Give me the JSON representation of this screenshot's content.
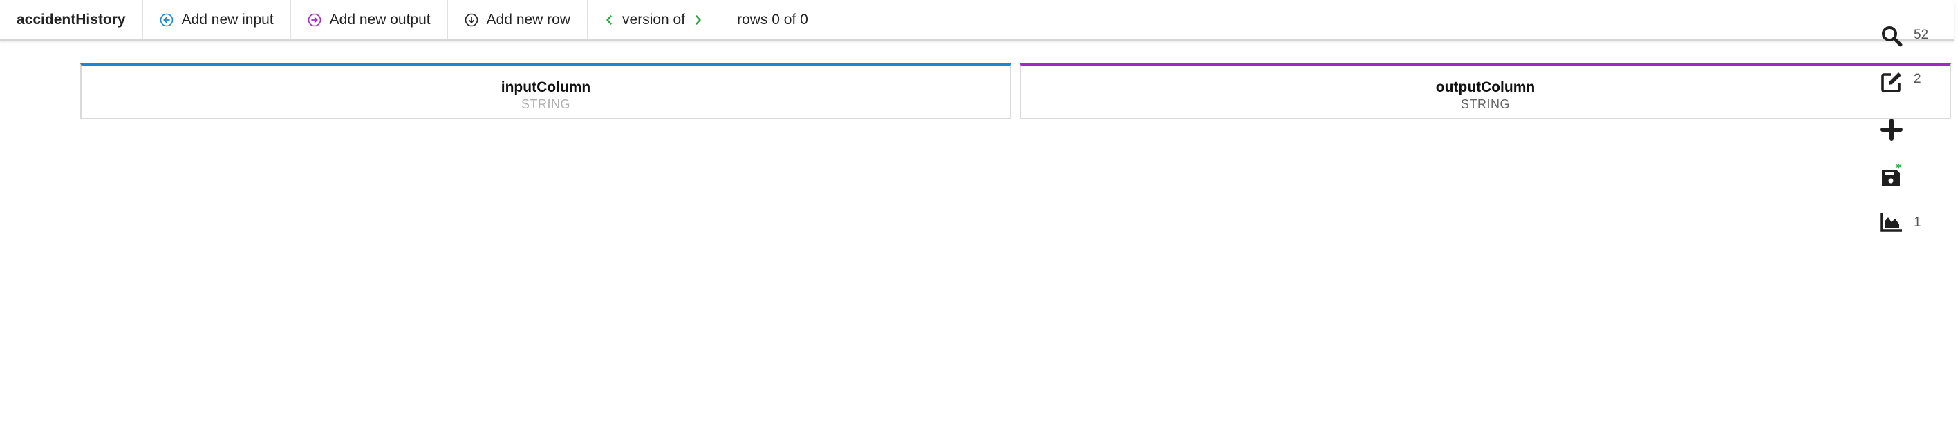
{
  "toolbar": {
    "title": "accidentHistory",
    "add_input_label": "Add new input",
    "add_output_label": "Add new output",
    "add_row_label": "Add new row",
    "version_label": "version of",
    "rows_label": "rows 0 of 0"
  },
  "columns": {
    "input": {
      "name": "inputColumn",
      "type": "STRING"
    },
    "output": {
      "name": "outputColumn",
      "type": "STRING"
    }
  },
  "side_panel": {
    "search_count": "52",
    "edit_count": "2",
    "chart_count": "1"
  },
  "colors": {
    "input_accent": "#1b85d6",
    "output_accent": "#a12ac4",
    "version_arrow": "#22a33a",
    "save_asterisk": "#2bb24c"
  },
  "icons": {
    "add_input": "arrow-left-circle-icon",
    "add_output": "arrow-right-circle-icon",
    "add_row": "arrow-down-circle-icon",
    "version_prev": "chevron-left-icon",
    "version_next": "chevron-right-icon",
    "search": "search-icon",
    "edit": "edit-icon",
    "add": "plus-icon",
    "save": "save-icon",
    "chart": "area-chart-icon"
  }
}
